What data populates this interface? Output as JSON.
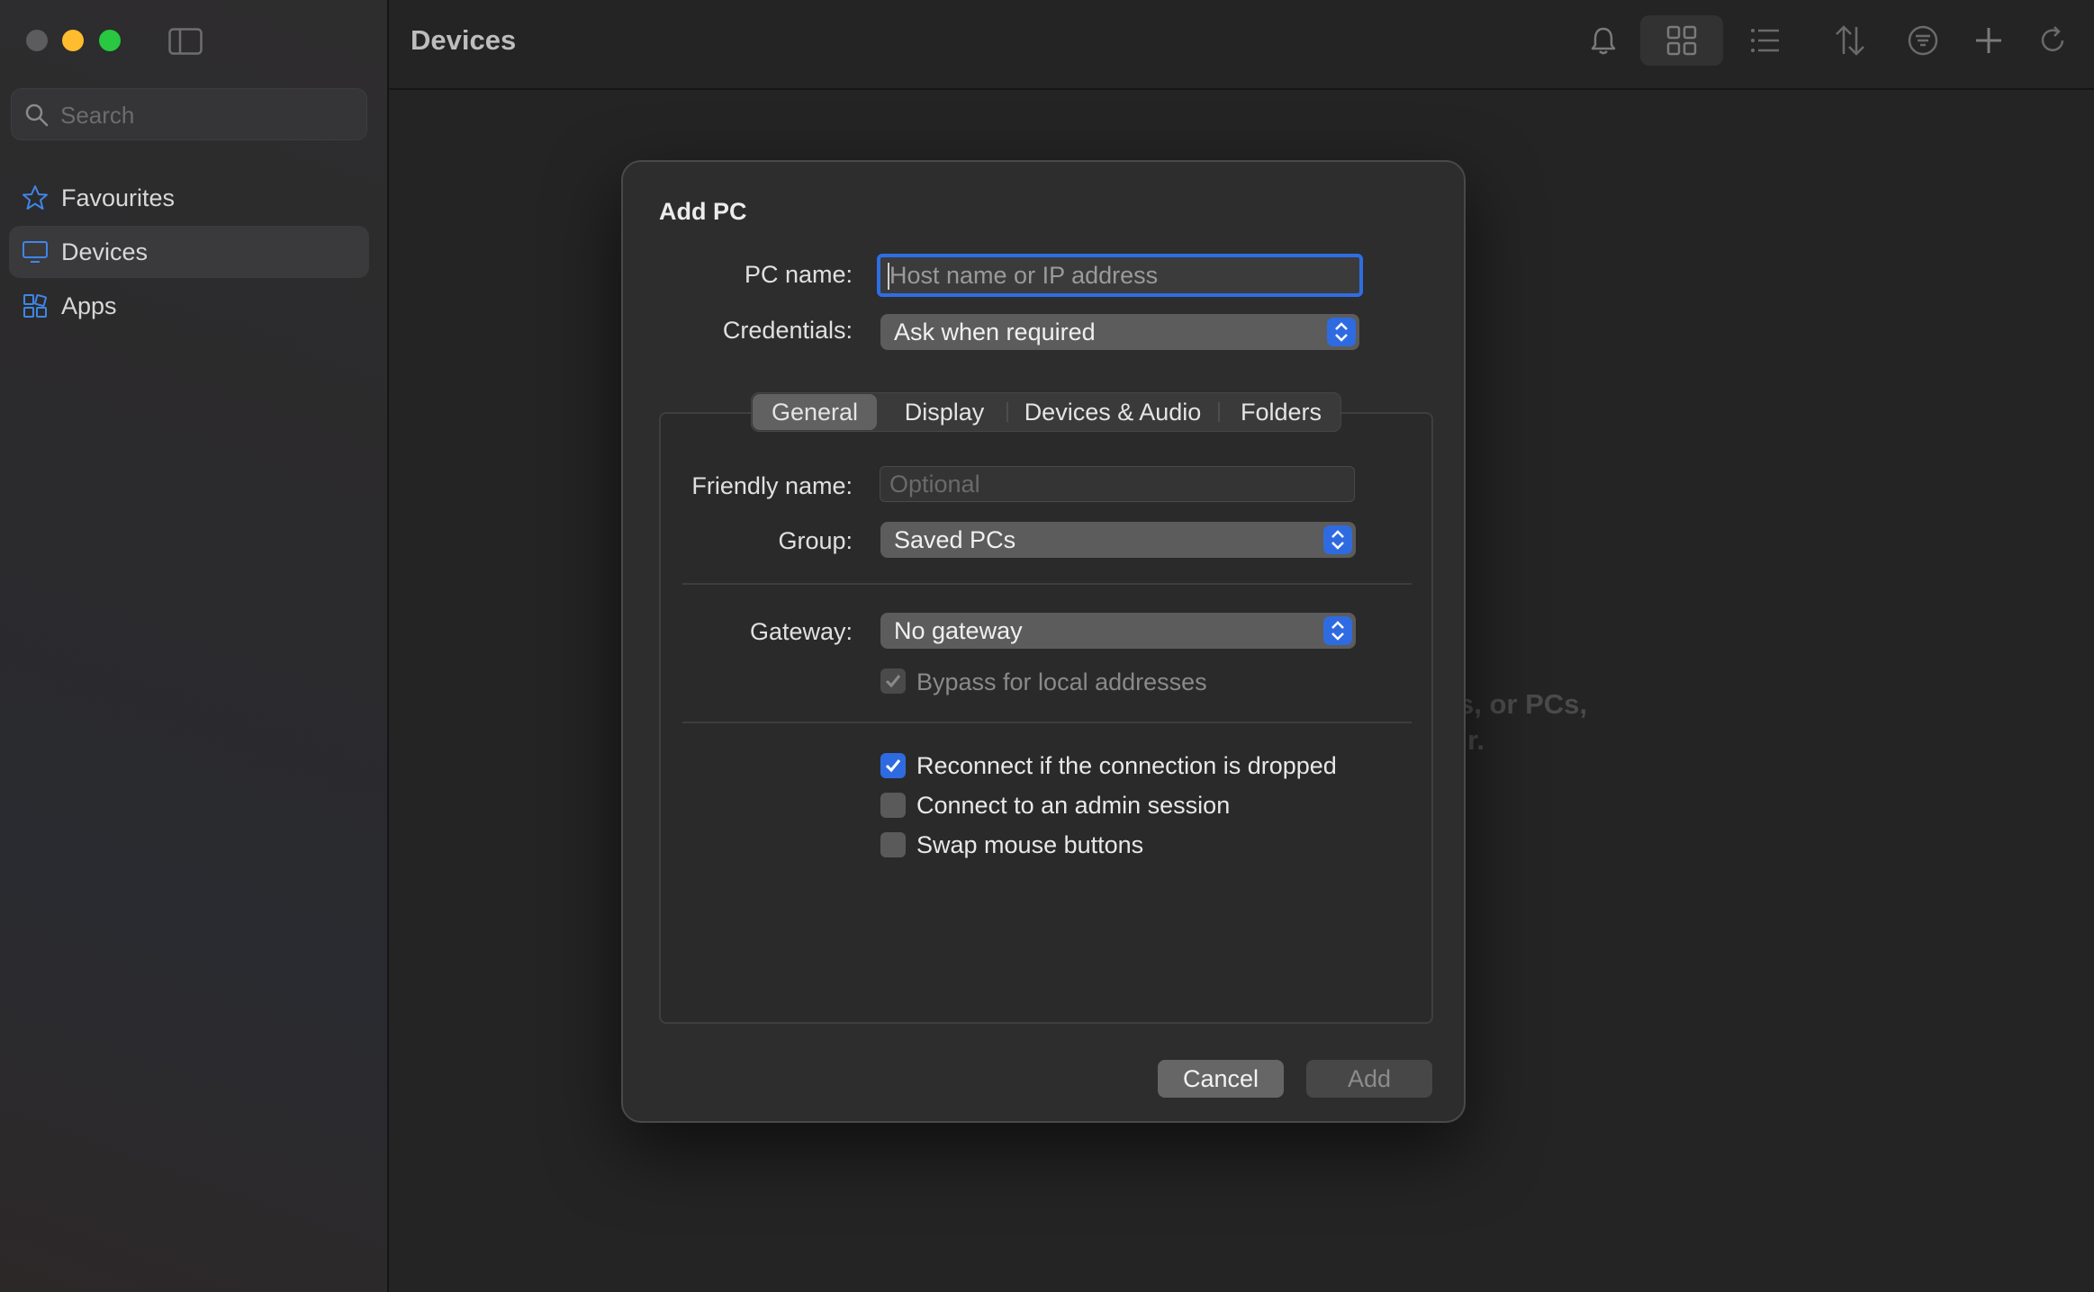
{
  "sidebar": {
    "search_placeholder": "Search",
    "items": [
      {
        "label": "Favourites",
        "icon": "star-icon"
      },
      {
        "label": "Devices",
        "icon": "monitor-icon",
        "active": true
      },
      {
        "label": "Apps",
        "icon": "apps-icon"
      }
    ]
  },
  "main": {
    "title": "Devices",
    "background_hint_line1": "s, or PCs,",
    "background_hint_line2": "r."
  },
  "toolbar": {
    "icons": [
      "bell-icon",
      "grid-view-icon",
      "list-view-icon",
      "sort-icon",
      "filter-icon",
      "add-icon",
      "refresh-icon"
    ]
  },
  "dialog": {
    "title": "Add PC",
    "pc_name_label": "PC name:",
    "pc_name_placeholder": "Host name or IP address",
    "credentials_label": "Credentials:",
    "credentials_value": "Ask when required",
    "tabs": [
      "General",
      "Display",
      "Devices & Audio",
      "Folders"
    ],
    "friendly_name_label": "Friendly name:",
    "friendly_name_placeholder": "Optional",
    "group_label": "Group:",
    "group_value": "Saved PCs",
    "gateway_label": "Gateway:",
    "gateway_value": "No gateway",
    "bypass_label": "Bypass for local addresses",
    "reconnect_label": "Reconnect if the connection is dropped",
    "admin_label": "Connect to an admin session",
    "swap_label": "Swap mouse buttons",
    "cancel_label": "Cancel",
    "add_label": "Add"
  },
  "colors": {
    "accent": "#2f6be0",
    "window_bg": "#242424",
    "dialog_bg": "#2d2d2d"
  }
}
